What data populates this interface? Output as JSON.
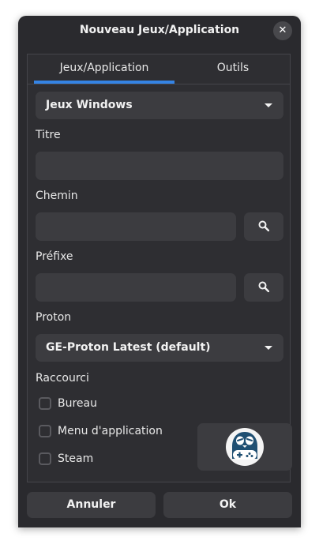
{
  "window": {
    "title": "Nouveau Jeux/Application",
    "close_glyph": "✕"
  },
  "tabs": [
    {
      "label": "Jeux/Application",
      "active": true
    },
    {
      "label": "Outils",
      "active": false
    }
  ],
  "accent_color": "#3584e4",
  "runner_dropdown": {
    "selected": "Jeux Windows"
  },
  "fields": {
    "titre": {
      "label": "Titre",
      "value": ""
    },
    "chemin": {
      "label": "Chemin",
      "value": ""
    },
    "prefixe": {
      "label": "Préfixe",
      "value": ""
    }
  },
  "proton": {
    "label": "Proton",
    "selected": "GE-Proton Latest (default)"
  },
  "raccourci": {
    "label": "Raccourci",
    "options": [
      {
        "label": "Bureau",
        "checked": false
      },
      {
        "label": "Menu d'application",
        "checked": false
      },
      {
        "label": "Steam",
        "checked": false
      }
    ]
  },
  "icons": {
    "search": "search-icon",
    "app_icon": "faugus-gamepad-penguin-icon"
  },
  "buttons": {
    "cancel": "Annuler",
    "ok": "Ok"
  }
}
